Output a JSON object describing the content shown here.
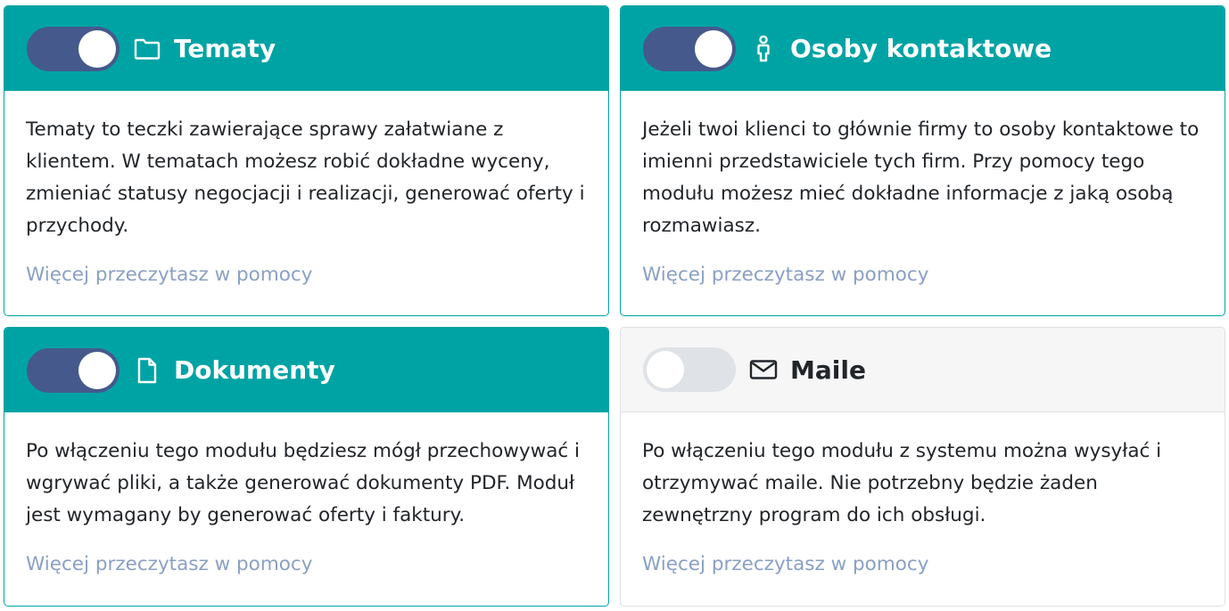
{
  "colors": {
    "header_on": "#00a3a4",
    "toggle_on": "#45598c",
    "toggle_off": "#dfe2e6",
    "link": "#8aa0c3"
  },
  "modules": [
    {
      "title": "Tematy",
      "icon": "folder-icon",
      "enabled": true,
      "description": "Tematy to teczki zawierające sprawy załatwiane z klientem. W tematach możesz robić dokładne wyceny, zmieniać statusy negocjacji i realizacji, generować oferty i przychody.",
      "link": "Więcej przeczytasz w pomocy"
    },
    {
      "title": "Osoby kontaktowe",
      "icon": "person-icon",
      "enabled": true,
      "description": "Jeżeli twoi klienci to głównie firmy to osoby kontaktowe to imienni przedstawiciele tych firm. Przy pomocy tego modułu możesz mieć dokładne informacje z jaką osobą rozmawiasz.",
      "link": "Więcej przeczytasz w pomocy"
    },
    {
      "title": "Dokumenty",
      "icon": "document-icon",
      "enabled": true,
      "description": "Po włączeniu tego modułu będziesz mógł przechowywać i wgrywać pliki, a także generować dokumenty PDF. Moduł jest wymagany by generować oferty i faktury.",
      "link": "Więcej przeczytasz w pomocy"
    },
    {
      "title": "Maile",
      "icon": "envelope-icon",
      "enabled": false,
      "description": "Po włączeniu tego modułu z systemu można wysyłać i otrzymywać maile. Nie potrzebny będzie żaden zewnętrzny program do ich obsługi.",
      "link": "Więcej przeczytasz w pomocy"
    }
  ]
}
